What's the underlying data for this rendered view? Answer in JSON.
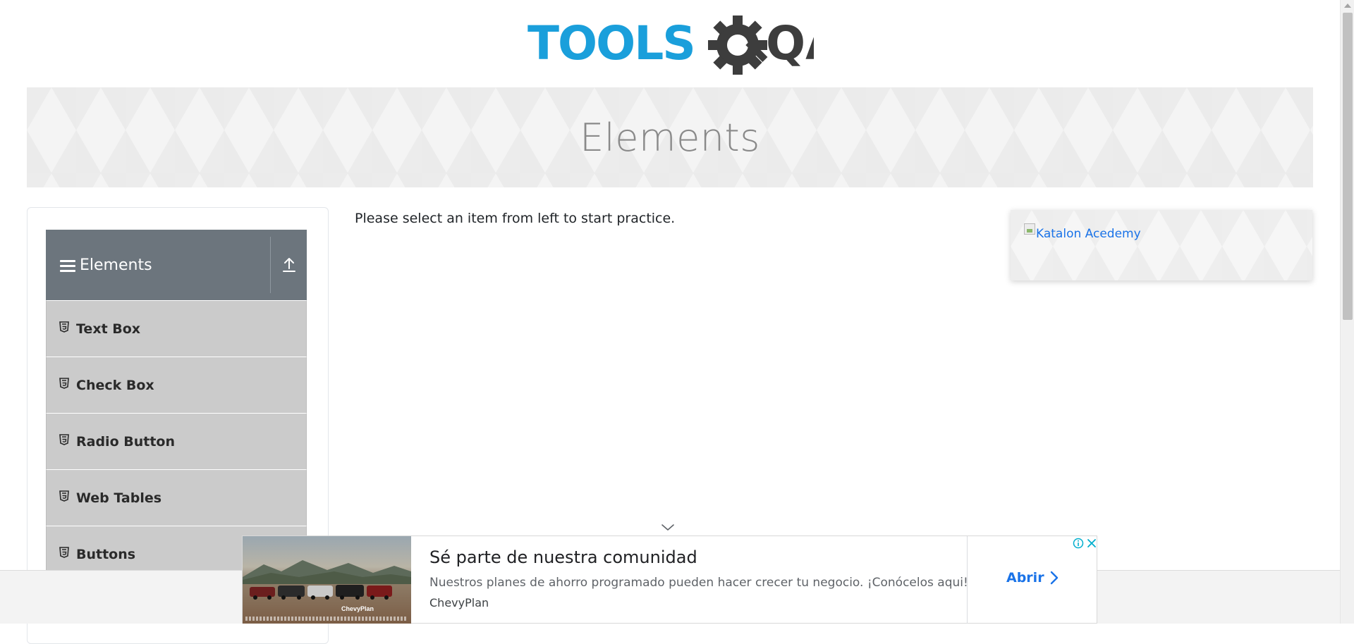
{
  "header": {
    "logo_text_tools": "TOOLS",
    "logo_text_qa": "QA",
    "logo_alt": "TOOLSQA"
  },
  "banner": {
    "title": "Elements"
  },
  "sidebar": {
    "group_title": "Elements",
    "items": [
      {
        "label": "Text Box",
        "icon": "html5-icon"
      },
      {
        "label": "Check Box",
        "icon": "html5-icon"
      },
      {
        "label": "Radio Button",
        "icon": "html5-icon"
      },
      {
        "label": "Web Tables",
        "icon": "html5-icon"
      },
      {
        "label": "Buttons",
        "icon": "html5-icon"
      }
    ]
  },
  "main": {
    "instruction": "Please select an item from left to start practice."
  },
  "right_ad": {
    "link_text": "Katalon Acedemy"
  },
  "bottom_ad": {
    "headline": "Sé parte de nuestra comunidad",
    "body": "Nuestros planes de ahorro programado pueden hacer crecer tu negocio. ¡Conócelos aqui!",
    "advertiser": "ChevyPlan",
    "cta": "Abrir",
    "image_brand": "ChevyPlan"
  },
  "colors": {
    "logo_blue": "#1a9fdb",
    "logo_dark": "#3d3d3d",
    "sidebar_header_bg": "#6c757d",
    "sidebar_item_bg": "#cbcbcb",
    "link_blue": "#1a73e8"
  }
}
